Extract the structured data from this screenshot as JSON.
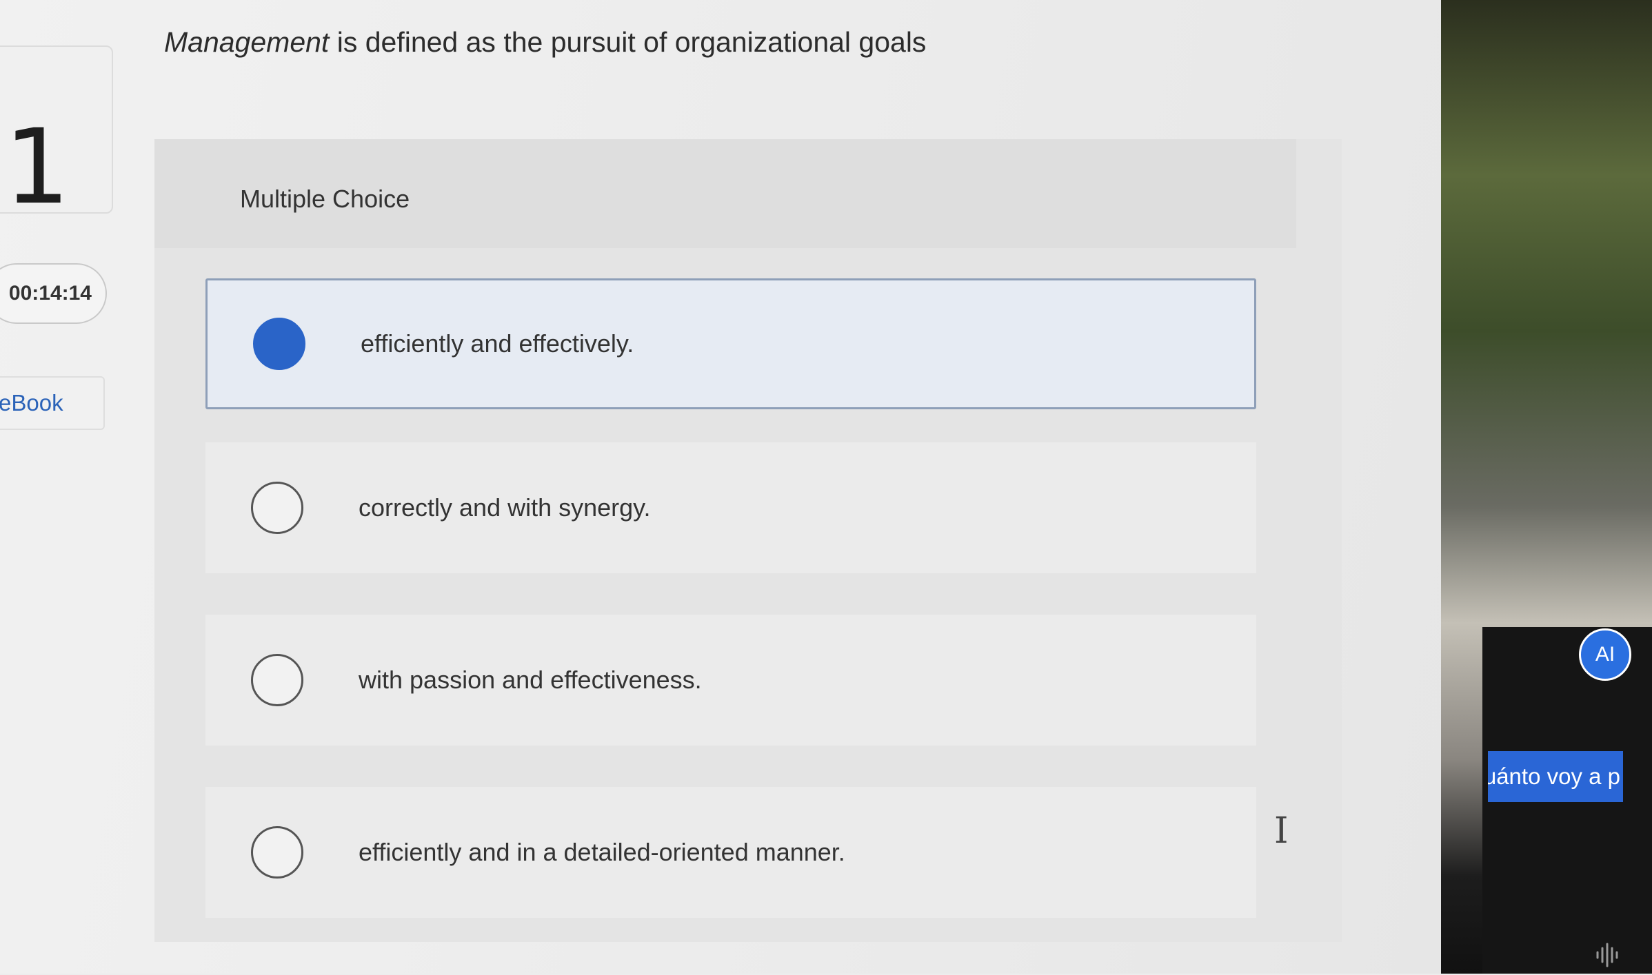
{
  "sidebar": {
    "question_number": "1",
    "timer": "00:14:14",
    "ebook_label": "eBook"
  },
  "question": {
    "term": "Management",
    "text": " is defined as the pursuit of organizational goals"
  },
  "choices": {
    "header": "Multiple Choice",
    "selected_index": 0,
    "options": [
      {
        "label": "efficiently and effectively.",
        "selected": true
      },
      {
        "label": "correctly and with synergy.",
        "selected": false
      },
      {
        "label": "with passion and effectiveness.",
        "selected": false
      },
      {
        "label": "efficiently and in a detailed-oriented manner.",
        "selected": false
      }
    ]
  },
  "overlay": {
    "avatar_text": "AI",
    "caption": "uánto voy a p"
  },
  "icons": {
    "cursor": "text-cursor-icon",
    "audio": "audio-waveform-icon"
  },
  "colors": {
    "accent": "#2a64c8"
  }
}
